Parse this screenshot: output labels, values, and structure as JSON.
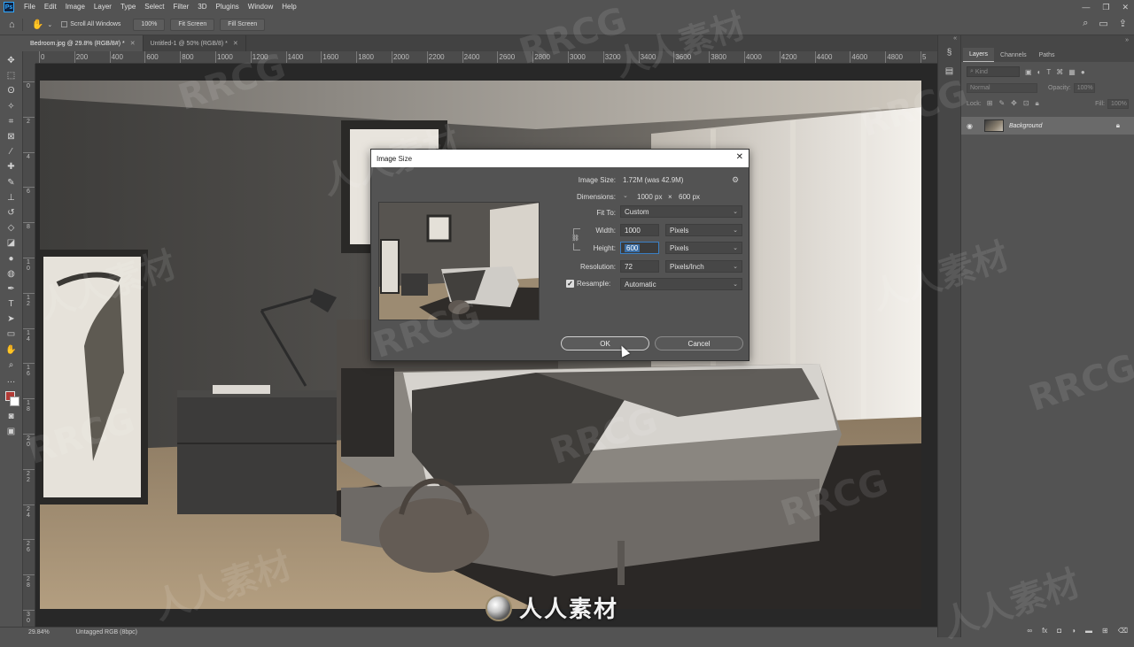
{
  "app": {
    "menu": [
      "File",
      "Edit",
      "Image",
      "Layer",
      "Type",
      "Select",
      "Filter",
      "3D",
      "Plugins",
      "Window",
      "Help"
    ],
    "logo": "Ps"
  },
  "options_bar": {
    "scroll_all_windows": "Scroll All Windows",
    "zoom_100": "100%",
    "fit_screen": "Fit Screen",
    "fill_screen": "Fill Screen"
  },
  "tabs": [
    {
      "label": "Bedroom.jpg @ 29.8% (RGB/8#) *",
      "active": true
    },
    {
      "label": "Untitled-1 @ 50% (RGB/8) *",
      "active": false
    }
  ],
  "rulers": {
    "top": [
      "0",
      "200",
      "400",
      "600",
      "800",
      "1000",
      "1200",
      "1400",
      "1600",
      "1800",
      "2000",
      "2200",
      "2400",
      "2600",
      "2800",
      "3000",
      "3200",
      "3400",
      "3600",
      "3800",
      "4000",
      "4200",
      "4400",
      "4600",
      "4800",
      "5"
    ],
    "left": [
      "0",
      "2",
      "4",
      "6",
      "8",
      "1 0",
      "1 2",
      "1 4",
      "1 6",
      "1 8",
      "2 0",
      "2 2",
      "2 4",
      "2 6",
      "2 8",
      "3 0"
    ]
  },
  "status_bar": {
    "zoom": "29.84%",
    "profile": "Untagged RGB (8bpc)"
  },
  "layers_panel": {
    "tabs": [
      "Layers",
      "Channels",
      "Paths"
    ],
    "filter_placeholder": "Kind",
    "blend_mode": "Normal",
    "opacity_label": "Opacity:",
    "opacity_value": "100%",
    "lock_label": "Lock:",
    "fill_label": "Fill:",
    "fill_value": "100%",
    "layer_name": "Background"
  },
  "dialog": {
    "title": "Image Size",
    "image_size_label": "Image Size:",
    "image_size_value": "1.72M (was 42.9M)",
    "dimensions_label": "Dimensions:",
    "dimensions_width": "1000 px",
    "dimensions_x": "×",
    "dimensions_height": "600 px",
    "fit_to_label": "Fit To:",
    "fit_to_value": "Custom",
    "width_label": "Width:",
    "width_value": "1000",
    "width_unit": "Pixels",
    "height_label": "Height:",
    "height_value": "600",
    "height_unit": "Pixels",
    "resolution_label": "Resolution:",
    "resolution_value": "72",
    "resolution_unit": "Pixels/Inch",
    "resample_label": "Resample:",
    "resample_checked": true,
    "resample_value": "Automatic",
    "ok_label": "OK",
    "cancel_label": "Cancel"
  },
  "watermark": {
    "text_latin": "RRCG",
    "text_cn": "人人素材",
    "brand_text": "人人素材"
  }
}
